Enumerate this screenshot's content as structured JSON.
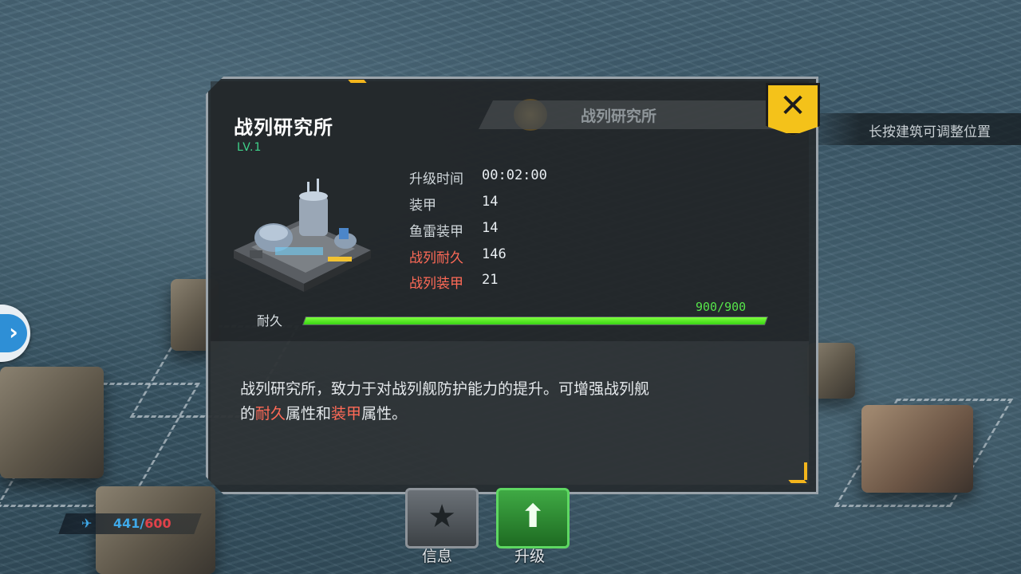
{
  "header": {
    "top_badge_text": "战列研究所"
  },
  "hint": {
    "text": "长按建筑可调整位置"
  },
  "power": {
    "current": "441",
    "separator": "/",
    "max": "600"
  },
  "panel": {
    "title": "战列研究所",
    "level": "LV.1",
    "stats": [
      {
        "label": "升级时间",
        "value": "00:02:00",
        "highlight": false
      },
      {
        "label": "装甲",
        "value": "14",
        "highlight": false
      },
      {
        "label": "鱼雷装甲",
        "value": "14",
        "highlight": false
      },
      {
        "label": "战列耐久",
        "value": "146",
        "highlight": true
      },
      {
        "label": "战列装甲",
        "value": "21",
        "highlight": true
      }
    ],
    "durability": {
      "label": "耐久",
      "value_text": "900/900",
      "fraction": 1.0
    },
    "description": {
      "line1": "战列研究所，致力于对战列舰防护能力的提升。可增强战列舰",
      "line2_part1": "的",
      "line2_hl1": "耐久",
      "line2_part2": "属性和",
      "line2_hl2": "装甲",
      "line2_part3": "属性。"
    }
  },
  "buttons": {
    "close_glyph": "✕",
    "info_label": "信息",
    "upgrade_label": "升级"
  },
  "colors": {
    "accent_yellow": "#f4c21a",
    "highlight_red": "#ff6a57",
    "level_green": "#3fd28a",
    "bar_green": "#56e34a"
  }
}
